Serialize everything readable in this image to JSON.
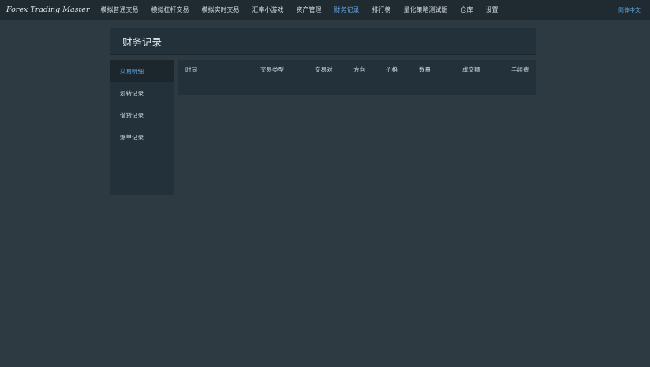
{
  "app": {
    "brand": "Forex Trading Master",
    "language": "简体中文"
  },
  "nav": {
    "items": [
      {
        "label": "模拟普通交易",
        "active": false
      },
      {
        "label": "模拟杠杆交易",
        "active": false
      },
      {
        "label": "模拟实时交易",
        "active": false
      },
      {
        "label": "汇率小游戏",
        "active": false
      },
      {
        "label": "资产管理",
        "active": false
      },
      {
        "label": "财务记录",
        "active": true
      },
      {
        "label": "排行榜",
        "active": false
      },
      {
        "label": "量化策略测试版",
        "active": false
      },
      {
        "label": "仓库",
        "active": false
      },
      {
        "label": "设置",
        "active": false
      }
    ]
  },
  "page": {
    "title": "财务记录"
  },
  "sidebar": {
    "items": [
      {
        "label": "交易明细",
        "active": true
      },
      {
        "label": "划转记录",
        "active": false
      },
      {
        "label": "借贷记录",
        "active": false
      },
      {
        "label": "爆单记录",
        "active": false
      }
    ]
  },
  "table": {
    "headers": [
      "时间",
      "交易类型",
      "交易对",
      "方向",
      "价格",
      "数量",
      "成交额",
      "手续费"
    ],
    "rows": []
  },
  "colors": {
    "accent": "#63a9e6",
    "background": "#2e3a42",
    "panel": "#23313a",
    "topbar": "#1f2a31"
  }
}
